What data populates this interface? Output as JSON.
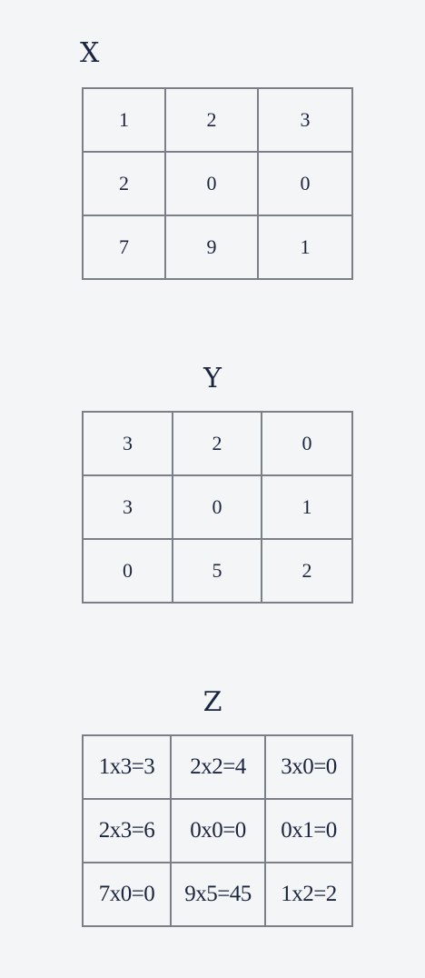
{
  "x": {
    "title": "X",
    "rows": [
      [
        "1",
        "2",
        "3"
      ],
      [
        "2",
        "0",
        "0"
      ],
      [
        "7",
        "9",
        "1"
      ]
    ]
  },
  "y": {
    "title": "Y",
    "rows": [
      [
        "3",
        "2",
        "0"
      ],
      [
        "3",
        "0",
        "1"
      ],
      [
        "0",
        "5",
        "2"
      ]
    ]
  },
  "z": {
    "title": "Z",
    "rows": [
      [
        "1x3=3",
        "2x2=4",
        "3x0=0"
      ],
      [
        "2x3=6",
        "0x0=0",
        "0x1=0"
      ],
      [
        "7x0=0",
        "9x5=45",
        "1x2=2"
      ]
    ]
  }
}
